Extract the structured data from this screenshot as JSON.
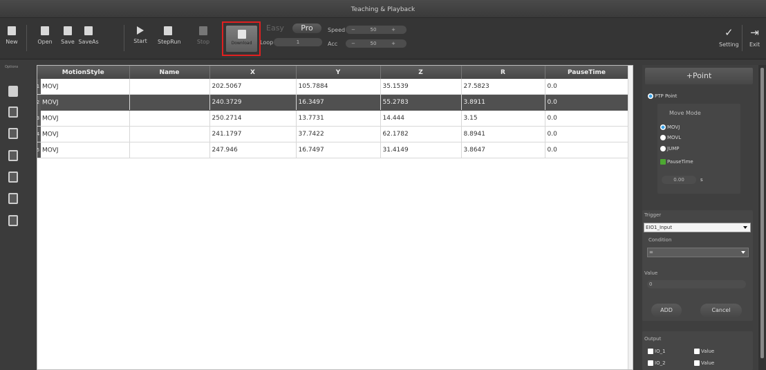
{
  "window": {
    "title": "Teaching & Playback"
  },
  "toolbar": {
    "new": "New",
    "open": "Open",
    "save": "Save",
    "save_as": "SaveAs",
    "start": "Start",
    "step_run": "StepRun",
    "stop": "Stop",
    "download": "Download",
    "easy_mode": "Easy",
    "pro_mode": "Pro",
    "loop_label": "Loop",
    "loop_value": "1",
    "speed_label": "Speed",
    "speed_value": "50",
    "acc_label": "Acc",
    "acc_value": "50",
    "minus": "−",
    "plus": "+",
    "setting": "Setting",
    "exit": "Exit"
  },
  "sidebar": {
    "top_label": "Options"
  },
  "table": {
    "columns": [
      "MotionStyle",
      "Name",
      "X",
      "Y",
      "Z",
      "R",
      "PauseTime"
    ],
    "selected_row": 1,
    "rows": [
      {
        "num": "1",
        "style": "MOVJ",
        "name": "",
        "x": "202.5067",
        "y": "105.7884",
        "z": "35.1539",
        "r": "27.5823",
        "pause": "0.0"
      },
      {
        "num": "2",
        "style": "MOVJ",
        "name": "",
        "x": "240.3729",
        "y": "16.3497",
        "z": "55.2783",
        "r": "3.8911",
        "pause": "0.0"
      },
      {
        "num": "3",
        "style": "MOVJ",
        "name": "",
        "x": "250.2714",
        "y": "13.7731",
        "z": "14.444",
        "r": "3.15",
        "pause": "0.0"
      },
      {
        "num": "4",
        "style": "MOVJ",
        "name": "",
        "x": "241.1797",
        "y": "37.7422",
        "z": "62.1782",
        "r": "8.8941",
        "pause": "0.0"
      },
      {
        "num": "5",
        "style": "MOVJ",
        "name": "",
        "x": "247.946",
        "y": "16.7497",
        "z": "31.4149",
        "r": "3.8647",
        "pause": "0.0"
      }
    ]
  },
  "panel": {
    "add_point": "+Point",
    "ptp_point": "PTP Point",
    "move_mode": "Move Mode",
    "movj": "MOVJ",
    "movl": "MOVL",
    "jump": "JUMP",
    "pause_time": "PauseTime",
    "pause_value": "0.00",
    "pause_unit": "s",
    "trigger": "Trigger",
    "trigger_value": "EIO1_Input",
    "condition": "Condition",
    "condition_value": "=",
    "value": "Value",
    "value_value": "0",
    "add": "ADD",
    "cancel": "Cancel",
    "output": "Output",
    "io1": "IO_1",
    "io2": "IO_2",
    "out_value": "Value"
  }
}
